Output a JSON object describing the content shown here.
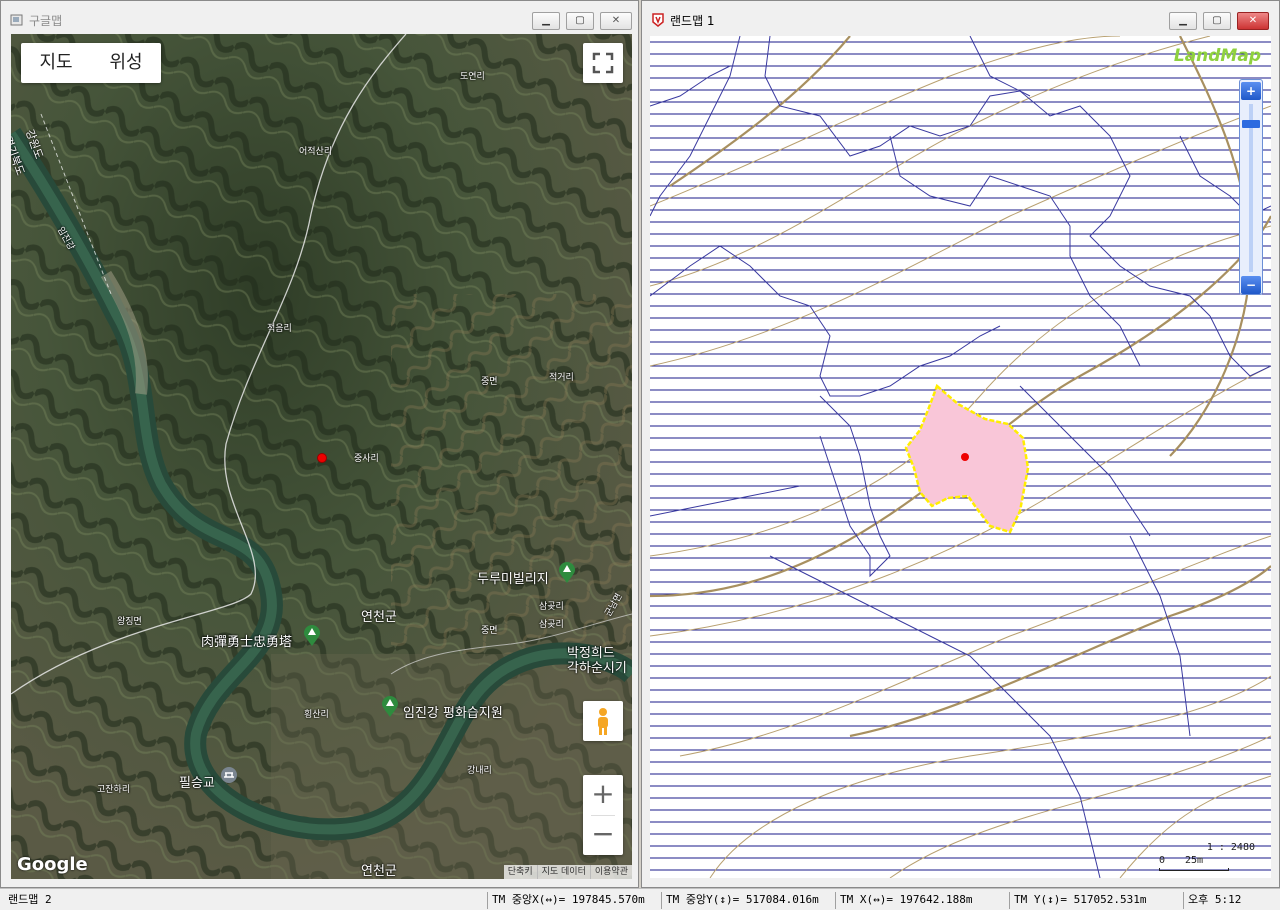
{
  "google_window": {
    "title": "구글맵",
    "map_type": {
      "map_label": "지도",
      "satellite_label": "위성"
    },
    "labels": [
      {
        "text": "도연리",
        "key": "l0"
      },
      {
        "text": "어적산리",
        "key": "l1"
      },
      {
        "text": "강원도",
        "key": "l2"
      },
      {
        "text": "경기북도",
        "key": "l3"
      },
      {
        "text": "임진강",
        "key": "l4"
      },
      {
        "text": "적음리",
        "key": "l5"
      },
      {
        "text": "중면",
        "key": "l6"
      },
      {
        "text": "적거리",
        "key": "l7"
      },
      {
        "text": "중사리",
        "key": "l8"
      },
      {
        "text": "삼곶리",
        "key": "l9"
      },
      {
        "text": "왕징면",
        "key": "l10"
      },
      {
        "text": "중면",
        "key": "l11"
      },
      {
        "text": "삼곶리",
        "key": "l12"
      },
      {
        "text": "군남면",
        "key": "l13"
      },
      {
        "text": "횡산리",
        "key": "l14"
      },
      {
        "text": "강내리",
        "key": "l15"
      },
      {
        "text": "고잔하리",
        "key": "l16"
      }
    ],
    "region_labels": {
      "yeoncheon_upper": "연천군",
      "yeoncheon_lower": "연천군",
      "pilseung": "필승교",
      "park": "박정희드",
      "park2": "각하순시기"
    },
    "poi": {
      "durumi": "두루미빌리지",
      "yukdan": "肉彈勇士忠勇塔",
      "imjin": "임진강 평화습지원"
    },
    "google_logo": "Google",
    "attribution": [
      "단축키",
      "지도 데이터",
      "이용약관"
    ]
  },
  "landmap_window": {
    "title": "랜드맵 1",
    "logo": "LandMap",
    "scale_text": "1 : 2480",
    "scale_zero": "0",
    "scale_len": "25m"
  },
  "status": {
    "app_name": "랜드맵 2",
    "tm_center_x": "TM 중앙X(↔)= 197845.570m",
    "tm_center_y": "TM 중앙Y(↕)= 517084.016m",
    "tm_x": "TM X(↔)= 197642.188m",
    "tm_y": "TM Y(↕)= 517052.531m",
    "clock": "오후 5:12"
  },
  "colors": {
    "parcel_fill": "#f9c6d8",
    "parcel_outline": "#ffee00",
    "contour_blue": "#3a3aa0",
    "contour_brown": "#b8a070",
    "hatch": "#1a1a88"
  }
}
